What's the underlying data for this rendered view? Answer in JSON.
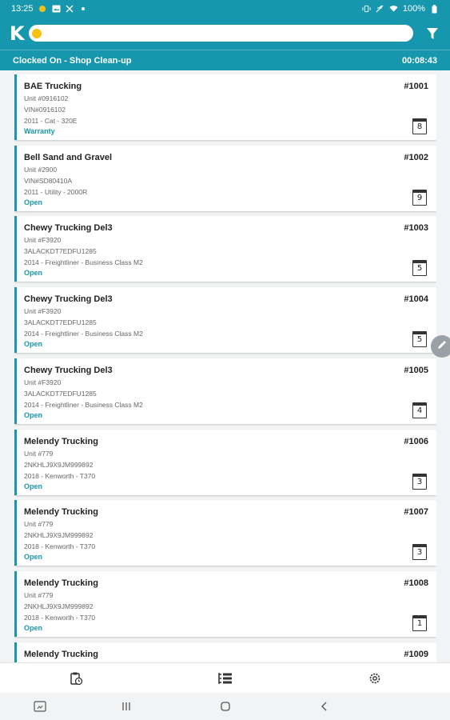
{
  "status_bar": {
    "time": "13:25",
    "battery": "100%",
    "icons": [
      "circle-dot-icon",
      "image-icon",
      "tools-icon",
      "small-dot-icon",
      "vibrate-icon",
      "mute-icon",
      "wifi-icon",
      "battery-icon"
    ]
  },
  "app_bar": {
    "logo_letter": "K",
    "logo_dot_color": "#f5c214",
    "search_value": "",
    "filter_icon": "filter-icon"
  },
  "clock_bar": {
    "label": "Clocked On - Shop Clean-up",
    "timer": "00:08:43"
  },
  "colors": {
    "brand": "#1797ad",
    "accent": "#f5c214"
  },
  "work_orders": [
    {
      "customer": "BAE Trucking",
      "number": "#1001",
      "unit": "Unit #0916102",
      "vin": "VIN#0916102",
      "vehicle": "2011 - Cat - 320E",
      "status": "Warranty",
      "count": "8"
    },
    {
      "customer": "Bell Sand and Gravel",
      "number": "#1002",
      "unit": "Unit #2900",
      "vin": "VIN#SD80410A",
      "vehicle": "2011 - Utility - 2000R",
      "status": "Open",
      "count": "9"
    },
    {
      "customer": "Chewy Trucking Del3",
      "number": "#1003",
      "unit": "Unit #F3920",
      "vin": "3ALACKDT7EDFU1285",
      "vehicle": "2014 - Freightliner - Business Class M2",
      "status": "Open",
      "count": "5"
    },
    {
      "customer": "Chewy Trucking Del3",
      "number": "#1004",
      "unit": "Unit #F3920",
      "vin": "3ALACKDT7EDFU1285",
      "vehicle": "2014 - Freightliner - Business Class M2",
      "status": "Open",
      "count": "5"
    },
    {
      "customer": "Chewy Trucking Del3",
      "number": "#1005",
      "unit": "Unit #F3920",
      "vin": "3ALACKDT7EDFU1285",
      "vehicle": "2014 - Freightliner - Business Class M2",
      "status": "Open",
      "count": "4"
    },
    {
      "customer": "Melendy Trucking",
      "number": "#1006",
      "unit": "Unit #779",
      "vin": "2NKHLJ9X9JM999892",
      "vehicle": "2018 - Kenworth - T370",
      "status": "Open",
      "count": "3"
    },
    {
      "customer": "Melendy Trucking",
      "number": "#1007",
      "unit": "Unit #779",
      "vin": "2NKHLJ9X9JM999892",
      "vehicle": "2018 - Kenworth - T370",
      "status": "Open",
      "count": "3"
    },
    {
      "customer": "Melendy Trucking",
      "number": "#1008",
      "unit": "Unit #779",
      "vin": "2NKHLJ9X9JM999892",
      "vehicle": "2018 - Kenworth - T370",
      "status": "Open",
      "count": "1"
    },
    {
      "customer": "Melendy Trucking",
      "number": "#1009",
      "unit": "",
      "vin": "",
      "vehicle": "",
      "status": "",
      "count": ""
    }
  ],
  "side_button_icon": "pencil-icon",
  "bottom_nav": [
    "clipboard-clock-icon",
    "work-order-list-icon",
    "settings-gear-icon"
  ],
  "system_nav": [
    "screenshot-icon",
    "recent-apps-icon",
    "home-icon",
    "back-icon"
  ]
}
